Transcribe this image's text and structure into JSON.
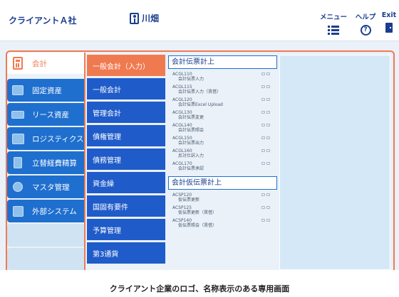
{
  "header": {
    "company_name": "クライアントＡ社",
    "user_name": "川畑",
    "menu_label": "メニュー",
    "help_label": "ヘルプ",
    "exit_label": "Exit"
  },
  "categories": [
    {
      "label": "会計",
      "icon": "calculator-icon",
      "active": true
    },
    {
      "label": "固定資産",
      "icon": "box-icon"
    },
    {
      "label": "リース資産",
      "icon": "truck-icon"
    },
    {
      "label": "ロジスティクス",
      "icon": "package-icon"
    },
    {
      "label": "立替経費精算",
      "icon": "bag-icon"
    },
    {
      "label": "マスタ管理",
      "icon": "gears-icon"
    },
    {
      "label": "外部システム",
      "icon": "puzzle-icon"
    }
  ],
  "groups": [
    {
      "label": "一般会計（入力）",
      "active": true
    },
    {
      "label": "一般会計"
    },
    {
      "label": "管理会計"
    },
    {
      "label": "債権管理"
    },
    {
      "label": "債務管理"
    },
    {
      "label": "資金繰"
    },
    {
      "label": "国固有要件"
    },
    {
      "label": "予算管理"
    },
    {
      "label": "第3通貨"
    }
  ],
  "sections": [
    {
      "title": "会計伝票計上",
      "items": [
        {
          "code": "ACGL110",
          "name": "会計伝票入力"
        },
        {
          "code": "ACGL115",
          "name": "会計伝票入力（賃借）"
        },
        {
          "code": "ACGL120",
          "name": "会計伝票Excel Upload"
        },
        {
          "code": "ACGL130",
          "name": "会計伝票変更"
        },
        {
          "code": "ACGL140",
          "name": "会計伝票照会"
        },
        {
          "code": "ACGL150",
          "name": "会計伝票出力"
        },
        {
          "code": "ACGL160",
          "name": "反対仕訳入力"
        },
        {
          "code": "ACGL170",
          "name": "会計伝票承認"
        }
      ]
    },
    {
      "title": "会計仮伝票計上",
      "items": [
        {
          "code": "ACSP120",
          "name": "仮伝票更新"
        },
        {
          "code": "ACSP125",
          "name": "仮伝票更新（賃借）"
        },
        {
          "code": "ACSP140",
          "name": "仮伝票照会（賃借）"
        }
      ]
    }
  ],
  "caption": "クライアント企業のロゴ、名称表示のある専用画面",
  "colors": {
    "accent": "#f07a50",
    "primary": "#1f5bc9",
    "text": "#1a3d8f"
  }
}
